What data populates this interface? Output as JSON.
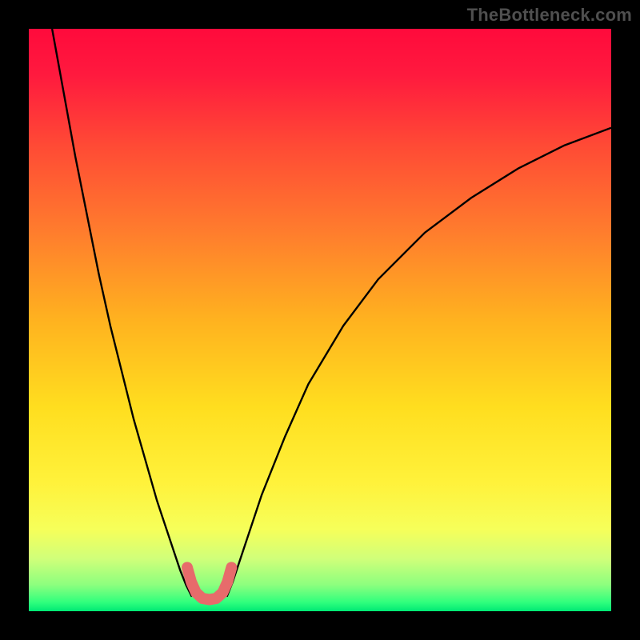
{
  "watermark": "TheBottleneck.com",
  "chart_data": {
    "type": "line",
    "title": "",
    "xlabel": "",
    "ylabel": "",
    "xlim": [
      0,
      100
    ],
    "ylim": [
      0,
      100
    ],
    "background_gradient": {
      "stops": [
        {
          "offset": 0.0,
          "color": "#ff0a3c"
        },
        {
          "offset": 0.08,
          "color": "#ff1a3e"
        },
        {
          "offset": 0.2,
          "color": "#ff4a35"
        },
        {
          "offset": 0.35,
          "color": "#ff7d2d"
        },
        {
          "offset": 0.5,
          "color": "#ffb21f"
        },
        {
          "offset": 0.65,
          "color": "#ffde1f"
        },
        {
          "offset": 0.78,
          "color": "#fff23b"
        },
        {
          "offset": 0.86,
          "color": "#f6ff5a"
        },
        {
          "offset": 0.91,
          "color": "#d0ff7a"
        },
        {
          "offset": 0.955,
          "color": "#8cff7e"
        },
        {
          "offset": 0.985,
          "color": "#2fff7d"
        },
        {
          "offset": 1.0,
          "color": "#00e874"
        }
      ]
    },
    "series": [
      {
        "name": "bottleneck-curve-left",
        "color": "#000000",
        "width": 2.4,
        "x": [
          4,
          6,
          8,
          10,
          12,
          14,
          16,
          18,
          20,
          22,
          24,
          25,
          26,
          27,
          28
        ],
        "y": [
          100,
          89,
          78,
          68,
          58,
          49,
          41,
          33,
          26,
          19,
          13,
          10,
          7,
          4.5,
          2.5
        ]
      },
      {
        "name": "bottleneck-curve-right",
        "color": "#000000",
        "width": 2.4,
        "x": [
          34,
          35,
          36,
          38,
          40,
          44,
          48,
          54,
          60,
          68,
          76,
          84,
          92,
          100
        ],
        "y": [
          2.5,
          5,
          8,
          14,
          20,
          30,
          39,
          49,
          57,
          65,
          71,
          76,
          80,
          83
        ]
      },
      {
        "name": "highlight-band",
        "color": "#e76b6b",
        "width": 14,
        "linecap": "round",
        "x": [
          27.2,
          27.9,
          28.7,
          29.8,
          31.0,
          32.2,
          33.3,
          34.1,
          34.8
        ],
        "y": [
          7.5,
          5.0,
          3.2,
          2.2,
          2.0,
          2.2,
          3.2,
          5.0,
          7.5
        ]
      }
    ]
  }
}
